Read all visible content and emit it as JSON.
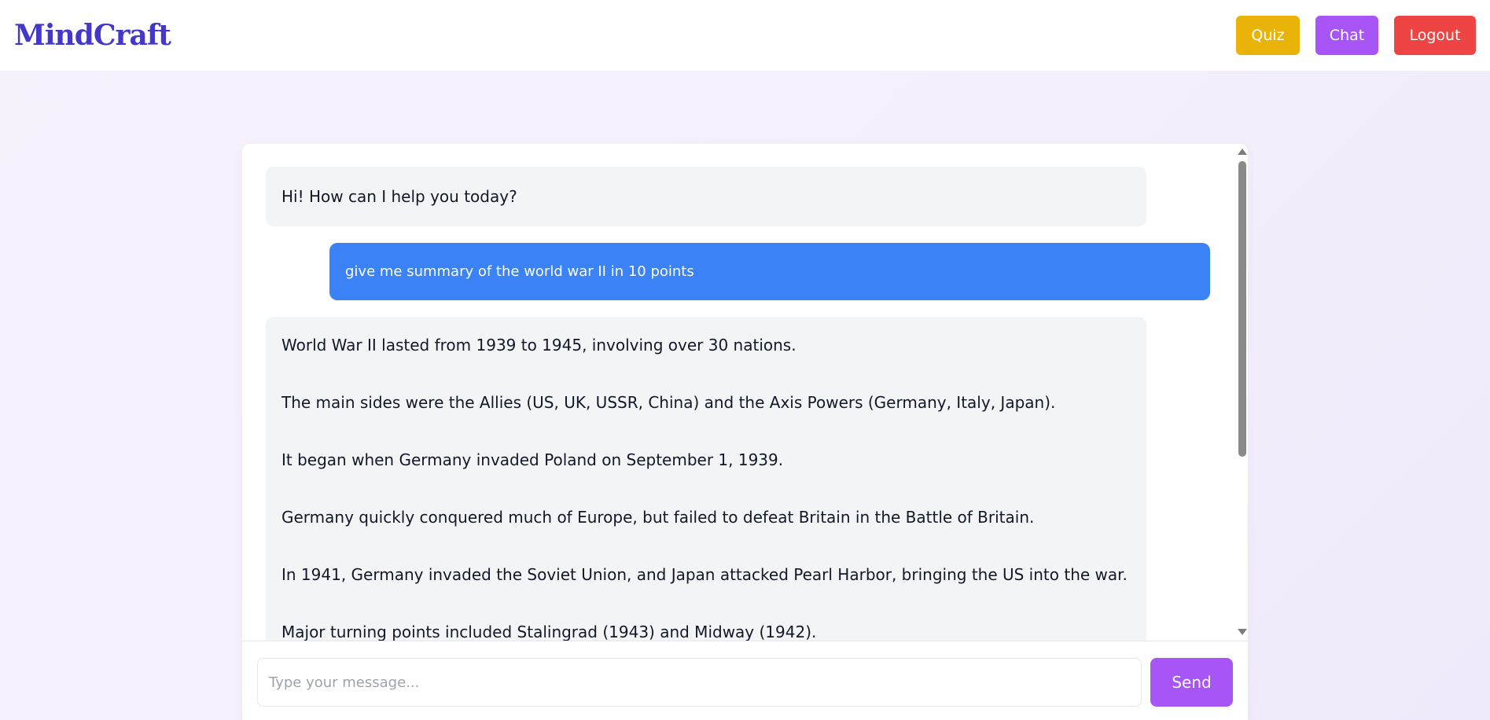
{
  "header": {
    "logo": "MindCraft",
    "nav": {
      "quiz_label": "Quiz",
      "chat_label": "Chat",
      "logout_label": "Logout"
    }
  },
  "colors": {
    "logo": "#4338ca",
    "quiz": "#eab308",
    "chat": "#a855f7",
    "logout": "#ef4444",
    "user_bubble": "#3b82f6",
    "bot_bubble": "#f3f4f6",
    "send": "#a855f7"
  },
  "chat": {
    "messages": [
      {
        "role": "bot",
        "text": "Hi! How can I help you today?"
      },
      {
        "role": "user",
        "text": "give me summary of the world war II in 10 points"
      },
      {
        "role": "bot",
        "lines": [
          "World War II lasted from 1939 to 1945, involving over 30 nations.",
          "The main sides were the Allies (US, UK, USSR, China) and the Axis Powers (Germany, Italy, Japan).",
          "It began when Germany invaded Poland on September 1, 1939.",
          "Germany quickly conquered much of Europe, but failed to defeat Britain in the Battle of Britain.",
          "In 1941, Germany invaded the Soviet Union, and Japan attacked Pearl Harbor, bringing the US into the war.",
          "Major turning points included Stalingrad (1943) and Midway (1942)."
        ]
      }
    ]
  },
  "composer": {
    "placeholder": "Type your message...",
    "value": "",
    "send_label": "Send"
  }
}
